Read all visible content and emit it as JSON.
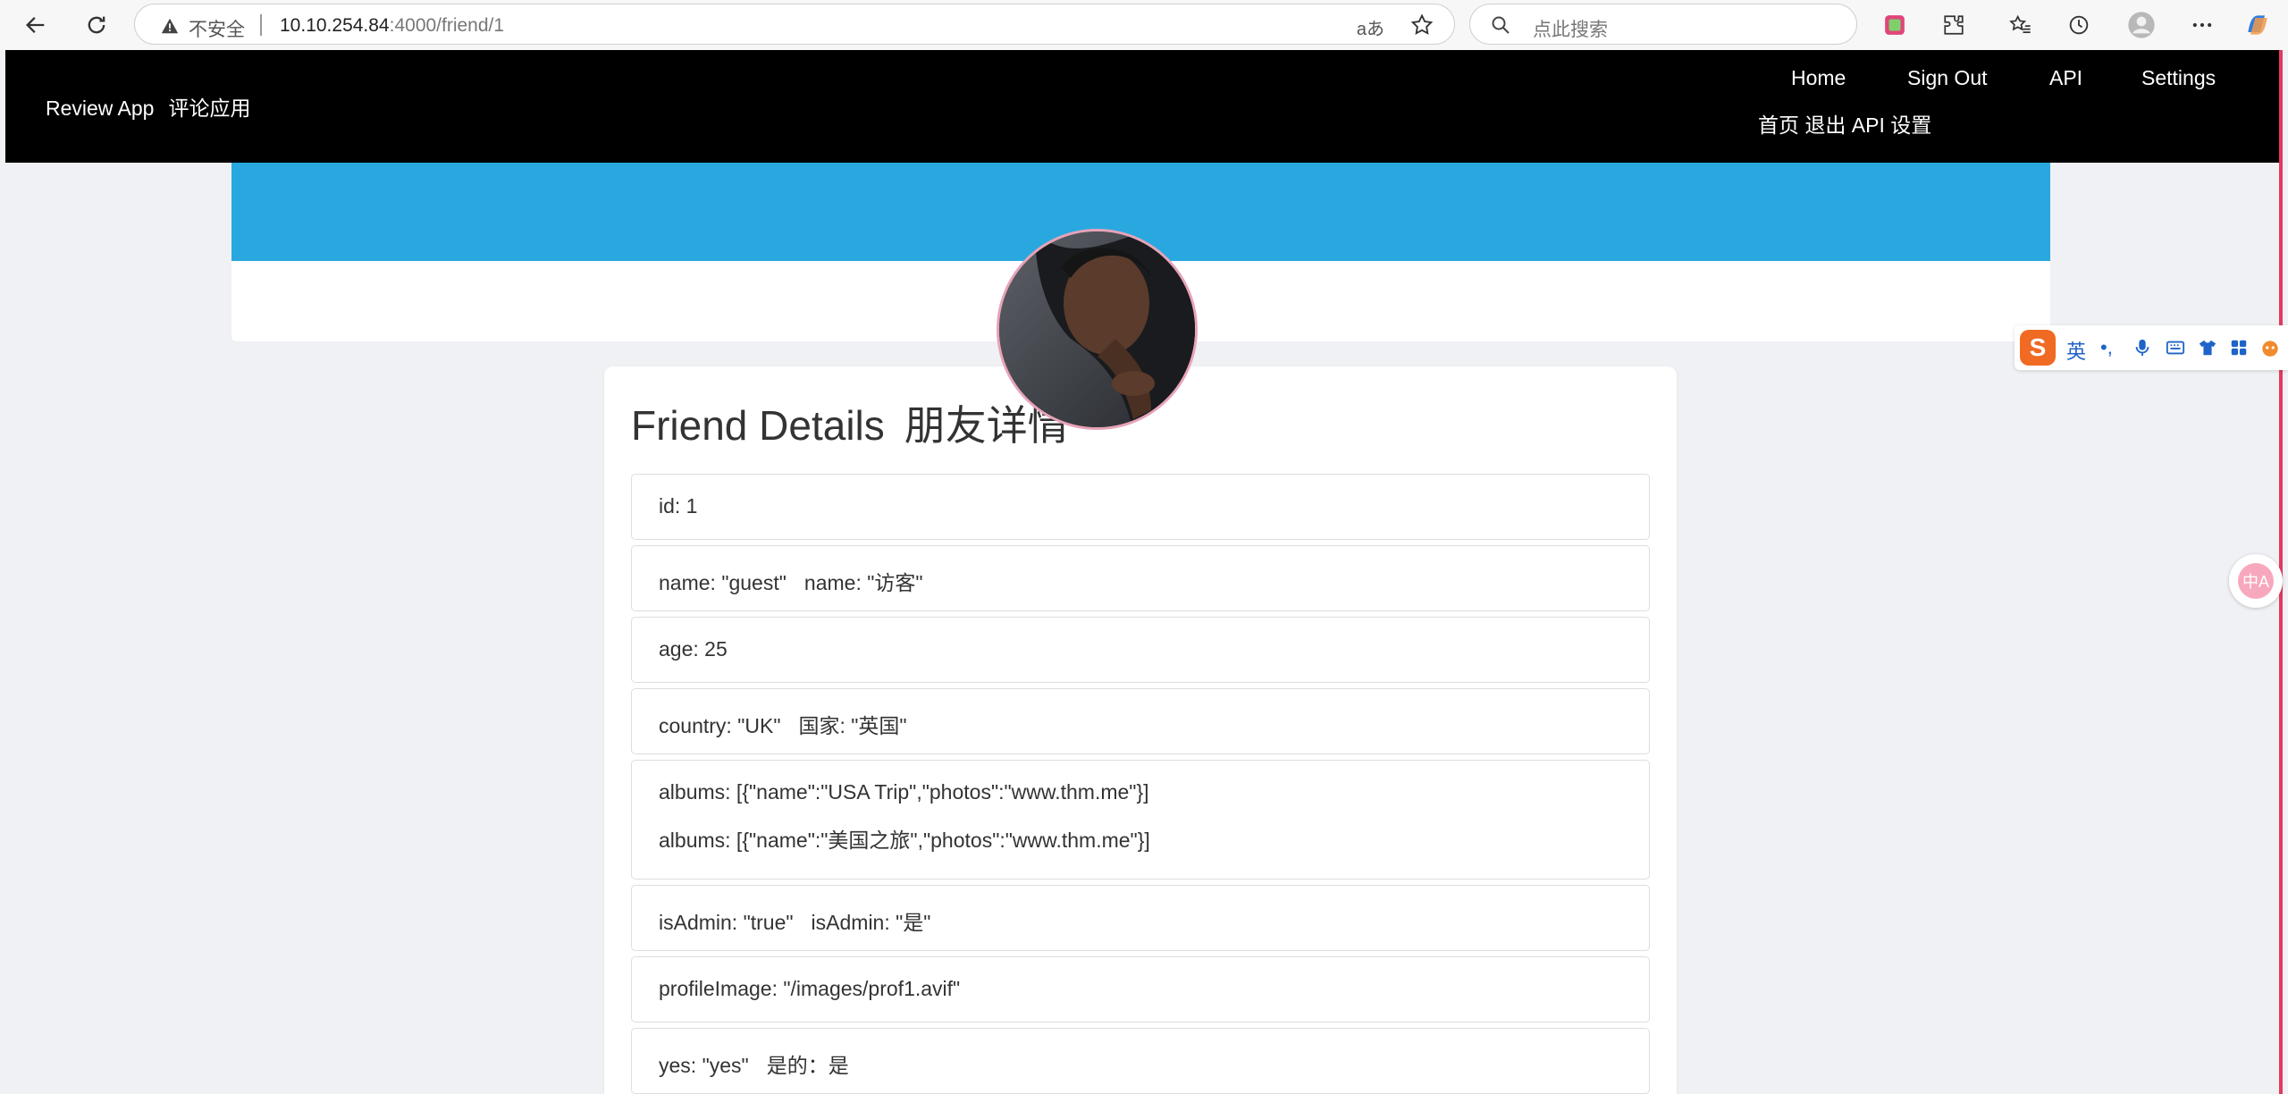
{
  "browser": {
    "security_label": "不安全",
    "url_host": "10.10.254.84",
    "url_path": ":4000/friend/1",
    "search_placeholder": "点此搜索",
    "read_aloud_label": "aあ"
  },
  "header": {
    "brand_en": "Review App",
    "brand_cn": "评论应用",
    "nav": [
      {
        "label": "Home"
      },
      {
        "label": "Sign Out"
      },
      {
        "label": "API"
      },
      {
        "label": "Settings"
      }
    ],
    "nav_cn": "首页 退出 API 设置"
  },
  "details": {
    "title_en": "Friend Details",
    "title_cn": "朋友详情",
    "fields": [
      {
        "text": "id: 1"
      },
      {
        "en": "name: \"guest\"",
        "cn": "name: \"访客\""
      },
      {
        "text": "age: 25"
      },
      {
        "en": "country: \"UK\"",
        "cn": "国家: \"英国\""
      },
      {
        "line1": "albums: [{\"name\":\"USA Trip\",\"photos\":\"www.thm.me\"}]",
        "line2": "albums: [{\"name\":\"美国之旅\",\"photos\":\"www.thm.me\"}]"
      },
      {
        "en": "isAdmin: \"true\"",
        "cn": "isAdmin: \"是\""
      },
      {
        "text": "profileImage: \"/images/prof1.avif\""
      },
      {
        "en": "yes: \"yes\"",
        "cn": "是的：是"
      }
    ]
  },
  "ime": {
    "mode": "英",
    "punct": "•,",
    "logo": "S"
  },
  "translate_bubble": "中A",
  "colors": {
    "header_bg": "#000000",
    "banner_blue": "#29a8e0",
    "page_bg": "#f0f1f4",
    "edge_accent": "#e43a5f"
  }
}
